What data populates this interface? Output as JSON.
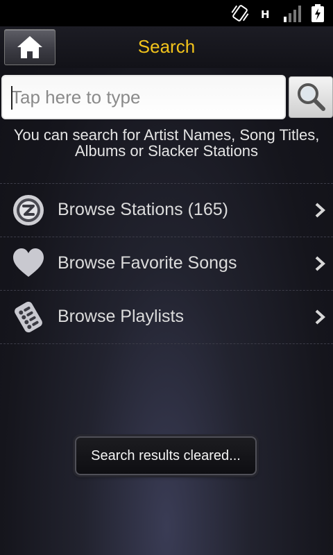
{
  "status_bar": {
    "icons": [
      "vibrate-icon",
      "network-h-icon",
      "signal-bars-icon",
      "battery-charging-icon"
    ],
    "network_label": "H"
  },
  "header": {
    "home_icon": "home-icon",
    "title": "Search",
    "title_color": "#f2c31b"
  },
  "search": {
    "placeholder": "Tap here to type",
    "value": "",
    "button_icon": "magnifier-icon"
  },
  "hint": {
    "line1": "You can search for Artist Names, Song Titles,",
    "line2": "Albums or Slacker Stations"
  },
  "browse": {
    "items": [
      {
        "icon": "slacker-station-icon",
        "label": "Browse Stations (165)"
      },
      {
        "icon": "heart-icon",
        "label": "Browse Favorite Songs"
      },
      {
        "icon": "playlist-icon",
        "label": "Browse Playlists"
      }
    ]
  },
  "toast": {
    "message": "Search results cleared..."
  }
}
